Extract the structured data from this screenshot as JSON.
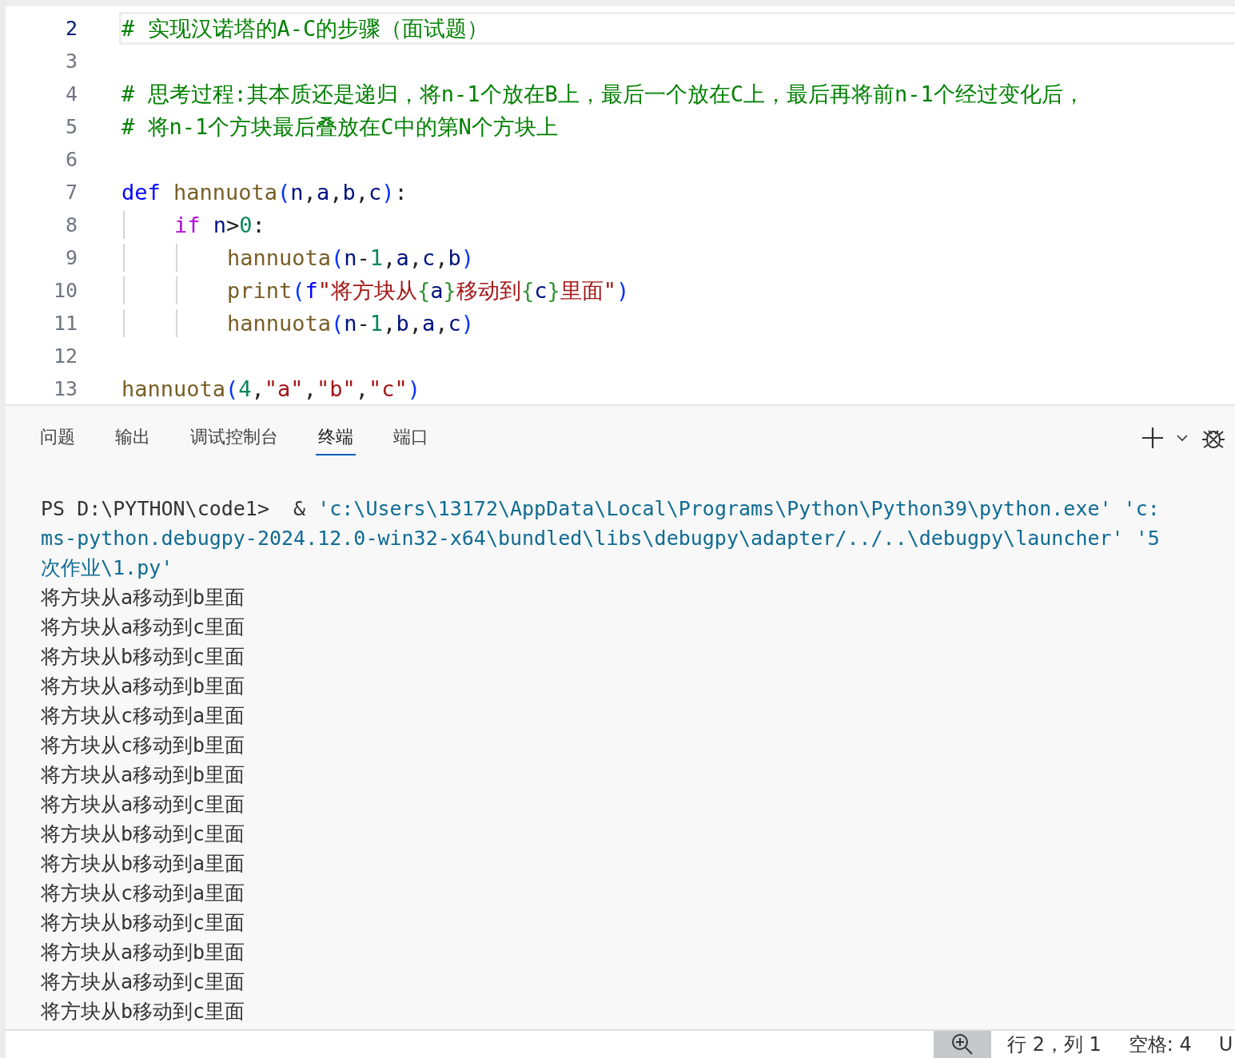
{
  "editor": {
    "lines": [
      {
        "number": "2",
        "selected": true,
        "tokens": [
          {
            "kind": "comment",
            "text": "# 实现汉诺塔的A-C的步骤（面试题）"
          }
        ]
      },
      {
        "number": "3",
        "selected": false
      },
      {
        "number": "4",
        "selected": false,
        "tokens": [
          {
            "kind": "comment",
            "text": "# 思考过程:其本质还是递归，将n-1个放在B上，最后一个放在C上，最后再将前n-1个经过变化后，"
          }
        ]
      },
      {
        "number": "5",
        "selected": false,
        "tokens": [
          {
            "kind": "comment",
            "text": "# 将n-1个方块最后叠放在C中的第N个方块上"
          }
        ]
      },
      {
        "number": "6",
        "selected": false
      },
      {
        "number": "7",
        "selected": false,
        "tokens": [
          {
            "kind": "keyword",
            "text": "def "
          },
          {
            "kind": "func",
            "text": "hannuota"
          },
          {
            "kind": "paren",
            "text": "("
          },
          {
            "kind": "var",
            "text": "n"
          },
          {
            "kind": "plain",
            "text": ","
          },
          {
            "kind": "var",
            "text": "a"
          },
          {
            "kind": "plain",
            "text": ","
          },
          {
            "kind": "var",
            "text": "b"
          },
          {
            "kind": "plain",
            "text": ","
          },
          {
            "kind": "var",
            "text": "c"
          },
          {
            "kind": "paren",
            "text": ")"
          },
          {
            "kind": "plain",
            "text": ":"
          }
        ],
        "children": [
          {
            "number": "8",
            "selected": false,
            "tokens": [
              {
                "kind": "control",
                "text": "if "
              },
              {
                "kind": "var",
                "text": "n"
              },
              {
                "kind": "plain",
                "text": ">"
              },
              {
                "kind": "num",
                "text": "0"
              },
              {
                "kind": "plain",
                "text": ":"
              }
            ],
            "children": [
              {
                "number": "9",
                "selected": false,
                "tokens": [
                  {
                    "kind": "func",
                    "text": "hannuota"
                  },
                  {
                    "kind": "paren",
                    "text": "("
                  },
                  {
                    "kind": "var",
                    "text": "n"
                  },
                  {
                    "kind": "plain",
                    "text": "-"
                  },
                  {
                    "kind": "num",
                    "text": "1"
                  },
                  {
                    "kind": "plain",
                    "text": ","
                  },
                  {
                    "kind": "var",
                    "text": "a"
                  },
                  {
                    "kind": "plain",
                    "text": ","
                  },
                  {
                    "kind": "var",
                    "text": "c"
                  },
                  {
                    "kind": "plain",
                    "text": ","
                  },
                  {
                    "kind": "var",
                    "text": "b"
                  },
                  {
                    "kind": "paren",
                    "text": ")"
                  }
                ]
              },
              {
                "number": "10",
                "selected": false,
                "tokens": [
                  {
                    "kind": "func",
                    "text": "print"
                  },
                  {
                    "kind": "paren",
                    "text": "("
                  },
                  {
                    "kind": "keyword",
                    "text": "f"
                  },
                  {
                    "kind": "str",
                    "text": "\"将方块从"
                  },
                  {
                    "kind": "brace",
                    "text": "{"
                  },
                  {
                    "kind": "var",
                    "text": "a"
                  },
                  {
                    "kind": "brace",
                    "text": "}"
                  },
                  {
                    "kind": "str",
                    "text": "移动到"
                  },
                  {
                    "kind": "brace",
                    "text": "{"
                  },
                  {
                    "kind": "var",
                    "text": "c"
                  },
                  {
                    "kind": "brace",
                    "text": "}"
                  },
                  {
                    "kind": "str",
                    "text": "里面\""
                  },
                  {
                    "kind": "paren",
                    "text": ")"
                  }
                ]
              },
              {
                "number": "11",
                "selected": false,
                "tokens": [
                  {
                    "kind": "func",
                    "text": "hannuota"
                  },
                  {
                    "kind": "paren",
                    "text": "("
                  },
                  {
                    "kind": "var",
                    "text": "n"
                  },
                  {
                    "kind": "plain",
                    "text": "-"
                  },
                  {
                    "kind": "num",
                    "text": "1"
                  },
                  {
                    "kind": "plain",
                    "text": ","
                  },
                  {
                    "kind": "var",
                    "text": "b"
                  },
                  {
                    "kind": "plain",
                    "text": ","
                  },
                  {
                    "kind": "var",
                    "text": "a"
                  },
                  {
                    "kind": "plain",
                    "text": ","
                  },
                  {
                    "kind": "var",
                    "text": "c"
                  },
                  {
                    "kind": "paren",
                    "text": ")"
                  }
                ]
              }
            ]
          }
        ]
      },
      {
        "number": "12",
        "selected": false
      },
      {
        "number": "13",
        "selected": false,
        "tokens": [
          {
            "kind": "func",
            "text": "hannuota"
          },
          {
            "kind": "paren",
            "text": "("
          },
          {
            "kind": "num",
            "text": "4"
          },
          {
            "kind": "plain",
            "text": ","
          },
          {
            "kind": "str",
            "text": "\"a\""
          },
          {
            "kind": "plain",
            "text": ","
          },
          {
            "kind": "str",
            "text": "\"b\""
          },
          {
            "kind": "plain",
            "text": ","
          },
          {
            "kind": "str",
            "text": "\"c\""
          },
          {
            "kind": "paren",
            "text": ")"
          }
        ]
      }
    ]
  },
  "panel": {
    "tabs": [
      {
        "label": "问题",
        "selected": false
      },
      {
        "label": "输出",
        "selected": false
      },
      {
        "label": "调试控制台",
        "selected": false
      },
      {
        "label": "终端",
        "selected": true
      },
      {
        "label": "端口",
        "selected": false
      }
    ],
    "terminal": [
      {
        "prompt": "PS D:\\PYTHON\\code1>  & ",
        "path": "'c:\\Users\\13172\\AppData\\Local\\Programs\\Python\\Python39\\python.exe' 'c:"
      },
      {
        "path": "ms-python.debugpy-2024.12.0-win32-x64\\bundled\\libs\\debugpy\\adapter/../..\\debugpy\\launcher' '5"
      },
      {
        "path": "次作业\\1.py'"
      },
      {
        "text": "将方块从a移动到b里面"
      },
      {
        "text": "将方块从a移动到c里面"
      },
      {
        "text": "将方块从b移动到c里面"
      },
      {
        "text": "将方块从a移动到b里面"
      },
      {
        "text": "将方块从c移动到a里面"
      },
      {
        "text": "将方块从c移动到b里面"
      },
      {
        "text": "将方块从a移动到b里面"
      },
      {
        "text": "将方块从a移动到c里面"
      },
      {
        "text": "将方块从b移动到c里面"
      },
      {
        "text": "将方块从b移动到a里面"
      },
      {
        "text": "将方块从c移动到a里面"
      },
      {
        "text": "将方块从b移动到c里面"
      },
      {
        "text": "将方块从a移动到b里面"
      },
      {
        "text": "将方块从a移动到c里面"
      },
      {
        "text": "将方块从b移动到c里面"
      }
    ]
  },
  "status_bar": {
    "items": [
      "行 2，列 1",
      "空格: 4",
      "U"
    ]
  }
}
